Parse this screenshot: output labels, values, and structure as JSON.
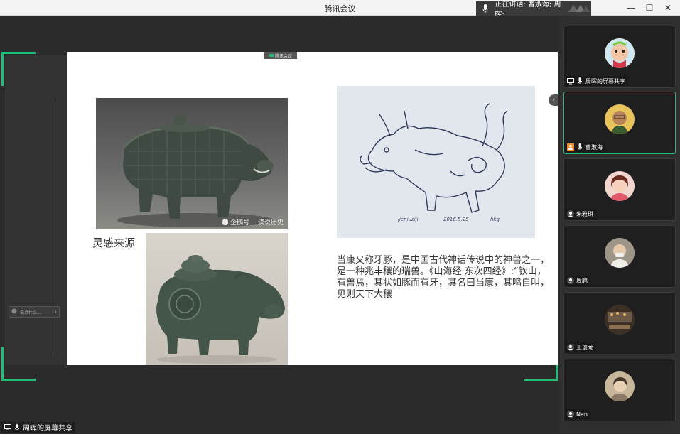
{
  "window": {
    "title": "腾讯会议",
    "speaking_label": "正在讲话: 曹淑海; 周晖;"
  },
  "window_controls": [
    "—",
    "☐",
    "✕"
  ],
  "share": {
    "slide_tag": "腾讯会议",
    "chat_placeholder": "说点什么...",
    "bottom_label": "周晖的屏幕共享"
  },
  "slide": {
    "inspiration_label": "灵感来源",
    "watermark": "企鹅号 一读说历史",
    "sketch_signature_left": "jieniuziji",
    "sketch_signature_mid": "2016.5.25",
    "sketch_signature_right": "hkg",
    "description": "当康又称牙豚，是中国古代神话传说中的神兽之一，是一种兆丰穰的瑞兽。《山海经·东次四经》:“钦山，有兽焉，其状如豚而有牙，其名曰当康，其鸣自叫，见则天下大穰"
  },
  "participants": [
    {
      "name": "周晖的屏幕共享",
      "icon": "screen-share-icon",
      "avatar_color": "#d9d3c9",
      "active": false
    },
    {
      "name": "曹淑海",
      "icon": "person-icon",
      "avatar_color": "#c8a065",
      "active": true
    },
    {
      "name": "朱雅琪",
      "icon": "user-badge-icon",
      "avatar_color": "#d89c8f",
      "active": false
    },
    {
      "name": "周鹏",
      "icon": "user-badge-icon",
      "avatar_color": "#b9b2a3",
      "active": false
    },
    {
      "name": "王俊龙",
      "icon": "user-badge-icon",
      "avatar_color": "#5a4a3f",
      "active": false
    },
    {
      "name": "Nan",
      "icon": "user-badge-icon",
      "avatar_color": "#a4937e",
      "active": false
    }
  ],
  "colors": {
    "accent_green": "#1dbe78",
    "background": "#2b2b2b",
    "tile": "#1f1f1f"
  }
}
